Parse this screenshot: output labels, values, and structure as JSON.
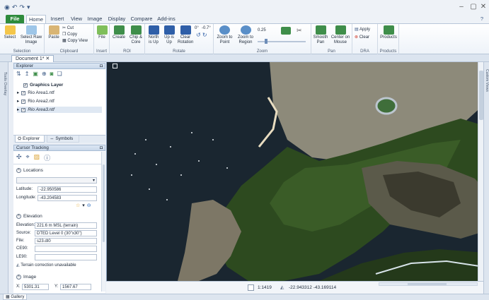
{
  "window": {
    "qat": [
      "◉",
      "↶",
      "↷",
      "▾"
    ],
    "min": "–",
    "max": "▢",
    "close": "✕",
    "help": "?"
  },
  "tabs": [
    "File",
    "Home",
    "Insert",
    "View",
    "Image",
    "Display",
    "Compare",
    "Add-ins"
  ],
  "ribbon": {
    "selection": {
      "label": "Selection",
      "select": "Select",
      "select_raw": "Select Raw Image"
    },
    "clipboard": {
      "label": "Clipboard",
      "paste": "Paste",
      "cut": "Cut",
      "copy": "Copy",
      "copy_view": "Copy View"
    },
    "insert": {
      "label": "Insert",
      "file": "File"
    },
    "roi": {
      "label": "ROI",
      "create": "Create",
      "chip": "Chip & Core"
    },
    "rotate": {
      "label": "Rotate",
      "north": "North is Up",
      "up": "Up is Up",
      "clear": "Clear Rotation",
      "deg0": "0°",
      "deg": "-0.7°"
    },
    "zoom": {
      "label": "Zoom",
      "point": "Zoom to Point",
      "region": "Zoom to Region",
      "value": "0.25"
    },
    "pan": {
      "label": "Pan",
      "smooth": "Smooth Pan",
      "center": "Center on Mouse"
    },
    "dra": {
      "label": "DRA",
      "apply": "Apply",
      "clear": "Clear"
    },
    "products": {
      "label": "Products",
      "products": "Products"
    }
  },
  "document": {
    "tab": "Document 1*"
  },
  "explorer": {
    "title": "Explorer",
    "pin": "◘",
    "items": [
      {
        "label": "Graphics Layer",
        "checked": "✓",
        "bold": true
      },
      {
        "label": "Rio Area1.ntf",
        "checked": "✓"
      },
      {
        "label": "Rio Area2.ntf",
        "checked": "✓"
      },
      {
        "label": "Rio Area3.ntf",
        "checked": "✓"
      }
    ],
    "tabs": [
      "Explorer",
      "Symbols"
    ]
  },
  "cursor": {
    "title": "Cursor Tracking",
    "locations": "Locations",
    "latitude_label": "Latitude:",
    "latitude": "-22.950586",
    "longitude_label": "Longitude:",
    "longitude": "-43.204583",
    "elevation": "Elevation",
    "elev_label": "Elevation:",
    "elev_value": "221.6 m MSL (terrain)",
    "source_label": "Source:",
    "source_value": "DTED Level 0 (30\"x30\")",
    "file_label": "File:",
    "file_value": "s23.dt0",
    "ce90_label": "CE90:",
    "le90_label": "LE90:",
    "terrain_note": "Terrain correction unavailable",
    "image": "Image",
    "x_label": "X:",
    "x_value": "5301.31",
    "y_label": "Y:",
    "y_value": "1567.67"
  },
  "status": {
    "scale": "1:1419",
    "coords": "-22.943312 -43.169114"
  },
  "bottom": {
    "gallery": "Gallery"
  },
  "strips": {
    "left": "Tools Overlay",
    "right": "Custom Views"
  }
}
